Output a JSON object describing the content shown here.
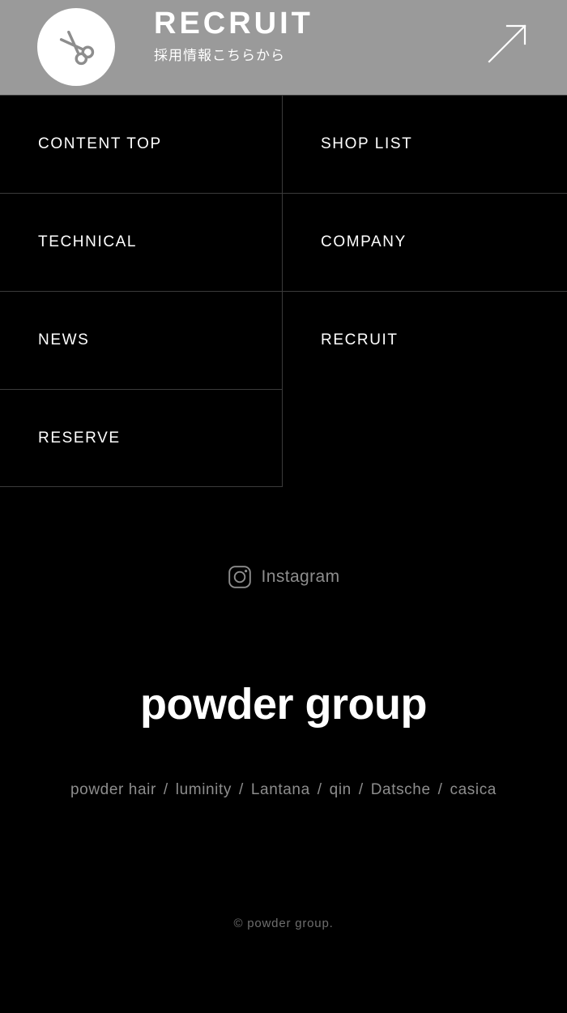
{
  "colors": {
    "page_background": "#000000",
    "banner_background": "#9a9a9a",
    "grid_border": "#3b3b3b",
    "primary_text": "#ffffff",
    "muted_text": "#8d8d8d",
    "copyright_text": "#6e6e6e"
  },
  "recruit_banner": {
    "title": "RECRUIT",
    "subtitle": "採用情報こちらから",
    "scissors_icon": "scissors-icon",
    "arrow_icon": "arrow-up-right-icon"
  },
  "nav": {
    "items": [
      {
        "label": "CONTENT TOP",
        "column": "left"
      },
      {
        "label": "SHOP LIST",
        "column": "right"
      },
      {
        "label": "TECHNICAL",
        "column": "left"
      },
      {
        "label": "COMPANY",
        "column": "right"
      },
      {
        "label": "NEWS",
        "column": "left"
      },
      {
        "label": "RECRUIT",
        "column": "right"
      },
      {
        "label": "RESERVE",
        "column": "left"
      }
    ]
  },
  "social": {
    "instagram_icon": "instagram-icon",
    "instagram_label": "Instagram"
  },
  "footer": {
    "logo": "powder group",
    "brands": [
      "powder hair",
      "luminity",
      "Lantana",
      "qin",
      "Datsche",
      "casica"
    ],
    "brand_separator": "/",
    "copyright": "© powder group."
  }
}
